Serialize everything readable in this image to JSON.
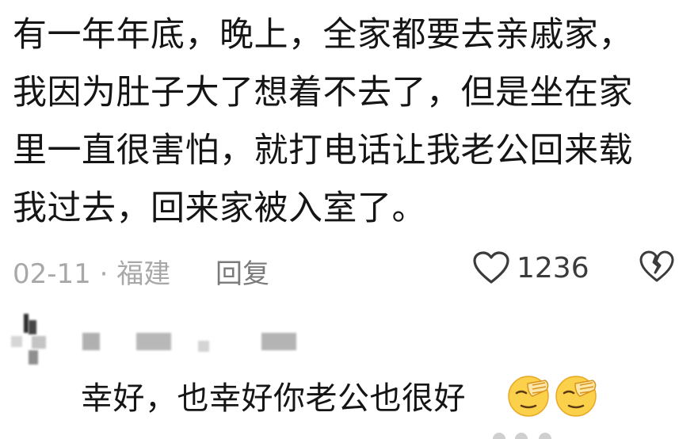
{
  "comment": {
    "lines": [
      "有一年年底，晚上，全家都要去亲戚家，",
      "我因为肚子大了想着不去了，但是坐在家",
      "里一直很害怕，就打电话让我老公回来载",
      "我过去，回来家被入室了。"
    ],
    "date_location": "02-11 · 福建",
    "reply_label": "回复",
    "like_count": "1236",
    "colors": {
      "text": "#151515",
      "meta": "#a8a8a8",
      "icon": "#3b3b3b"
    }
  },
  "reply": {
    "text": "幸好，也幸好你老公也很好",
    "emojis": [
      "facepalm-emoji",
      "facepalm-emoji"
    ]
  }
}
